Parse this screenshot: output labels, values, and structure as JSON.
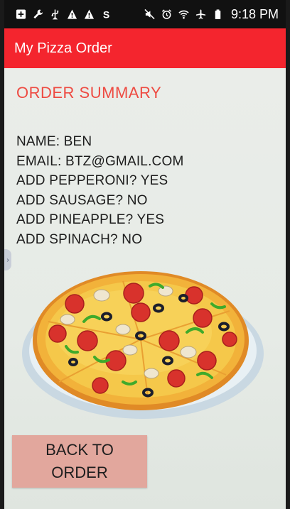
{
  "status_bar": {
    "time": "9:18 PM",
    "left_icons": [
      "add-box-icon",
      "wrench-icon",
      "usb-icon",
      "warning-icon",
      "warning-icon",
      "s-app-icon"
    ],
    "right_icons": [
      "mute-icon",
      "alarm-icon",
      "wifi-icon",
      "airplane-icon",
      "battery-icon"
    ]
  },
  "app_bar": {
    "title": "My Pizza Order"
  },
  "summary": {
    "title": "ORDER SUMMARY",
    "lines": [
      "NAME: BEN",
      "EMAIL: BTZ@GMAIL.COM",
      "ADD PEPPERONI? YES",
      "ADD SAUSAGE? NO",
      "ADD PINEAPPLE? YES",
      "ADD SPINACH? NO"
    ]
  },
  "back_button": {
    "label": "BACK TO ORDER"
  },
  "colors": {
    "app_bar": "#f4252e",
    "summary_title": "#ee4b42",
    "button": "#e2a79d",
    "background": "#e9ece9"
  }
}
